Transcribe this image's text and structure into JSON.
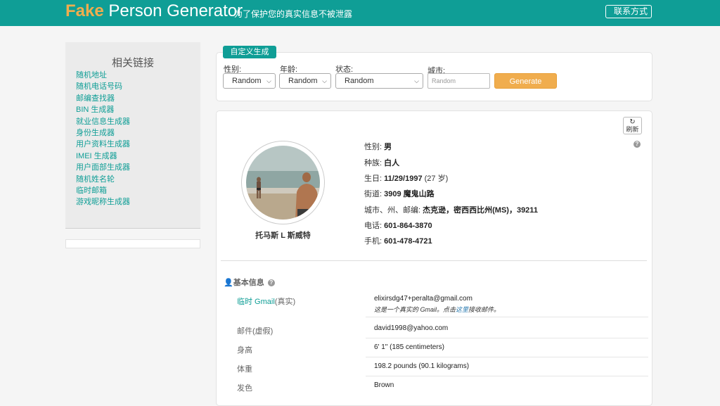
{
  "header": {
    "logo_fake": "Fake",
    "logo_rest": "Person Generator",
    "slogan": "为了保护您的真实信息不被泄露",
    "contact_label": "联系方式",
    "accent_color": "#0f9e96",
    "logo_accent_color": "#f0ad4e"
  },
  "sidebar": {
    "title": "相关链接",
    "links": [
      "随机地址",
      "随机电话号码",
      "邮编查找器",
      "BIN 生成器",
      "就业信息生成器",
      "身份生成器",
      "用户资料生成器",
      "IMEI 生成器",
      "用户面部生成器",
      "随机姓名轮",
      "临时邮箱",
      "游戏昵称生成器"
    ]
  },
  "custom_form": {
    "tab_label": "自定义生成",
    "gender_label": "性别:",
    "gender_value": "Random",
    "age_label": "年龄:",
    "age_value": "Random",
    "state_label": "状态:",
    "state_value": "Random",
    "city_label": "城市:",
    "city_placeholder": "Random",
    "generate_label": "Generate",
    "generate_color": "#f0ad4e"
  },
  "person": {
    "refresh_label": "刷新",
    "name": "托马斯 L 斯威特",
    "gender_label": "性别:",
    "gender": "男",
    "race_label": "种族:",
    "race": "白人",
    "birthday_label": "生日:",
    "birthday": "11/29/1997",
    "age_text": "(27 岁)",
    "age_num": "27",
    "street_label": "街道:",
    "street": "3909 魔鬼山路",
    "city_state_zip_label": "城市、州、邮编:",
    "city_state_zip": "杰克逊，密西西比州(MS)，39211",
    "phone_label": "电话:",
    "phone": "601-864-3870",
    "mobile_label": "手机:",
    "mobile": "601-478-4721"
  },
  "basic_info": {
    "title": "基本信息",
    "gmail_label": "临时 Gmail",
    "gmail_suffix": "(真实)",
    "gmail_value": "elixirsdg47+peralta@gmail.com",
    "gmail_note_before": "这是一个真实的 Gmail。点击",
    "gmail_note_link": "这里",
    "gmail_note_after": "接收邮件。",
    "email_label": "邮件(虚假)",
    "email_value": "david1998@yahoo.com",
    "height_label": "身高",
    "height_value": "6' 1\" (185 centimeters)",
    "weight_label": "体重",
    "weight_value": "198.2 pounds (90.1 kilograms)",
    "hair_label": "发色",
    "hair_value": "Brown"
  }
}
